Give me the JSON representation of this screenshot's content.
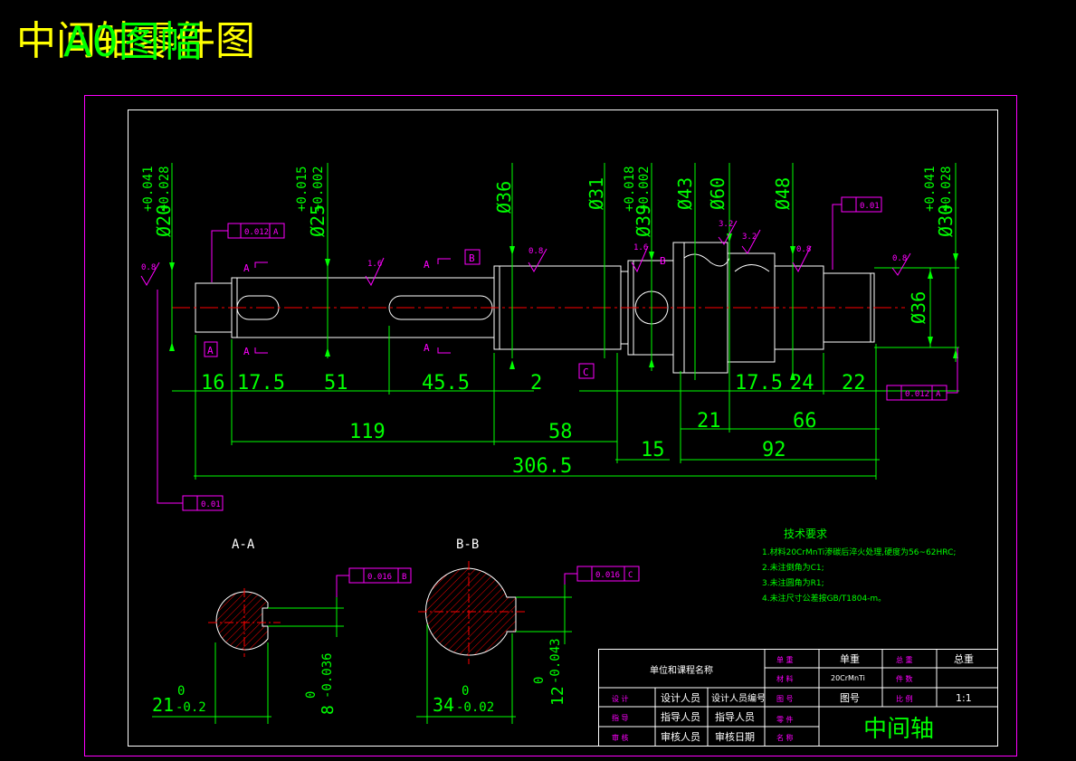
{
  "header": {
    "title": "中间轴零件图",
    "overlay": "A0图幅"
  },
  "colors": {
    "frame": "#ff00ff",
    "inner_frame": "#ffffff",
    "dimension": "#00ff00",
    "geometry": "#ffffff",
    "centerline": "#ff0000",
    "annotation": "#ff00ff",
    "title_yellow": "#ffff00",
    "hatch": "#ff0000"
  },
  "tolerances": {
    "d20": {
      "dia": "Ø20",
      "upper": "+0.041",
      "lower": "+0.028"
    },
    "d25": {
      "dia": "Ø25",
      "upper": "+0.015",
      "lower": "+0.002"
    },
    "d36": "Ø36",
    "d31": "Ø31",
    "d39": {
      "dia": "Ø39",
      "upper": "+0.018",
      "lower": "+0.002"
    },
    "d43": "Ø43",
    "d60": "Ø60",
    "d48": "Ø48",
    "d30": {
      "dia": "Ø30",
      "upper": "+0.041",
      "lower": "+0.028"
    },
    "d36_right": "Ø36"
  },
  "roughness": {
    "r1": "0.8",
    "r2": "1.6",
    "r3": "0.8",
    "r4": "1.6",
    "r5": "3.2",
    "r6": "3.2",
    "r7": "0.8",
    "r8": "0.8"
  },
  "geo_tolerances": {
    "left_top": {
      "value": "0.012",
      "datum": "A"
    },
    "left_bottom": {
      "value": "0.01"
    },
    "right_top": {
      "value": "0.01"
    },
    "right_bottom": {
      "value": "0.012",
      "datum": "A"
    },
    "section_a": {
      "value": "0.016",
      "datum": "B"
    },
    "section_b": {
      "value": "0.016",
      "datum": "C"
    }
  },
  "datums": {
    "a": "A",
    "b": "B",
    "c": "C",
    "b2": "B"
  },
  "section_marks": {
    "a1": "A",
    "a2": "A",
    "a3": "A",
    "a4": "A"
  },
  "dimensions": {
    "d16": "16",
    "d17_5": "17.5",
    "d51": "51",
    "d45_5": "45.5",
    "d2": "2",
    "d17_5b": "17.5",
    "d24": "24",
    "d22": "22",
    "d119": "119",
    "d58": "58",
    "d21": "21",
    "d66": "66",
    "d15": "15",
    "d92": "92",
    "d306_5": "306.5"
  },
  "sections": {
    "aa_label": "A-A",
    "bb_label": "B-B",
    "aa_width": {
      "nominal": "21",
      "tol_upper": "0",
      "tol_lower": "-0.2"
    },
    "aa_key": {
      "nominal": "8",
      "tol_upper": "0",
      "tol_lower": "-0.036"
    },
    "bb_width": {
      "nominal": "34",
      "tol_upper": "0",
      "tol_lower": "-0.02"
    },
    "bb_key": {
      "nominal": "12",
      "tol_upper": "0",
      "tol_lower": "-0.043"
    }
  },
  "tech_requirements": {
    "heading": "技术要求",
    "items": [
      "1.材料20CrMnTi渗碳后淬火处理,硬度为56~62HRC;",
      "2.未注倒角为C1;",
      "3.未注圆角为R1;",
      "4.未注尺寸公差按GB/T1804-m。"
    ]
  },
  "title_block": {
    "unit_name": "单位和课程名称",
    "c_weight_lbl": "单 重",
    "c_weight_val": "单重",
    "c_total_lbl": "总 重",
    "c_total_val": "总重",
    "c_material_lbl": "材 料",
    "c_material_val": "20CrMnTi",
    "c_qty_lbl": "件 数",
    "c_drawno_lbl": "图 号",
    "c_drawno_val": "图号",
    "c_scale_lbl": "比 例",
    "c_scale_val": "1:1",
    "r_design_lbl": "设 计",
    "r_design_val": "设计人员",
    "r_design_no": "设计人员编号",
    "r_guide_lbl": "指 导",
    "r_guide_val": "指导人员",
    "r_guide_val2": "指导人员",
    "r_review_lbl": "审 核",
    "r_review_val": "审核人员",
    "r_review_date": "审核日期",
    "part_lbl1": "零 件",
    "part_lbl2": "名 称",
    "part_name": "中间轴"
  }
}
